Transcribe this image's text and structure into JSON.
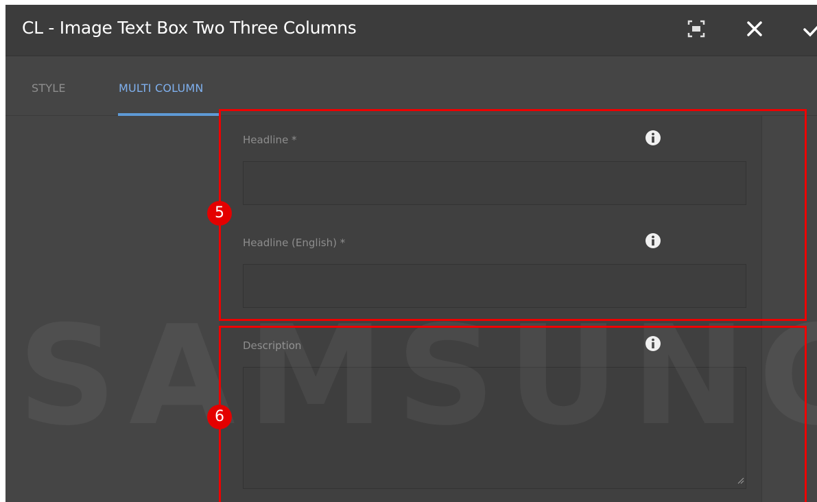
{
  "dialog": {
    "title": "CL - Image Text Box Two Three Columns"
  },
  "toolbar": {
    "fullscreen_icon": "fullscreen-icon",
    "close_icon": "close-icon",
    "confirm_icon": "checkmark-icon"
  },
  "tabs": [
    {
      "label": "STYLE",
      "active": false
    },
    {
      "label": "MULTI COLUMN",
      "active": true
    }
  ],
  "fields": {
    "headline": {
      "label": "Headline *",
      "value": ""
    },
    "headline_english": {
      "label": "Headline (English) *",
      "value": ""
    },
    "description": {
      "label": "Description",
      "value": ""
    }
  },
  "watermark": {
    "text": "SAMSUNG"
  },
  "annotations": [
    {
      "number": "5",
      "color": "#e40000"
    },
    {
      "number": "6",
      "color": "#e40000"
    }
  ],
  "colors": {
    "accent": "#5e9ad6",
    "highlight": "#ee0000"
  }
}
